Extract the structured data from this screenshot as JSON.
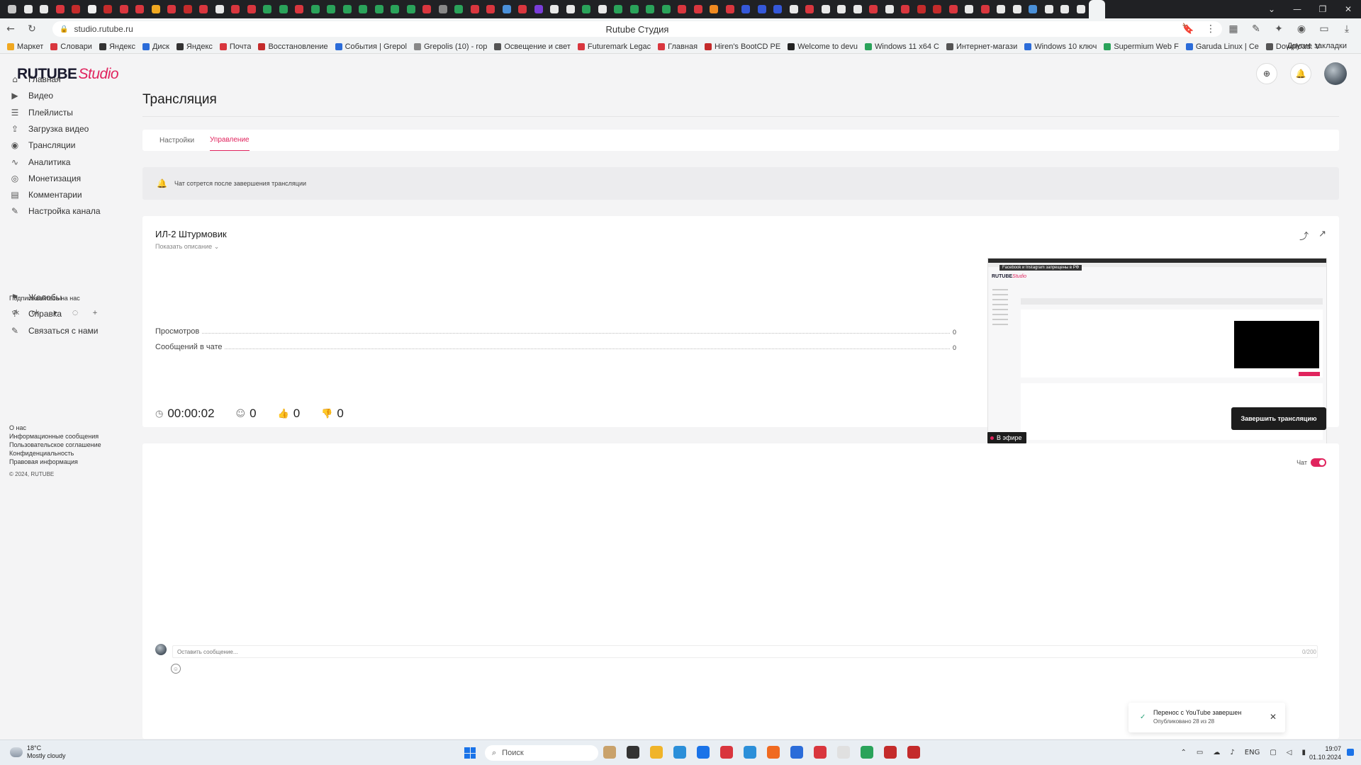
{
  "browser": {
    "url": "studio.rutube.ru",
    "page_title": "Rutube Студия",
    "tab_colors": [
      "#c7c7c7",
      "#e8e8e8",
      "#e8e8e8",
      "#d9363e",
      "#c42b2b",
      "#f0f0f0",
      "#c42b2b",
      "#d9363e",
      "#d9363e",
      "#f0a820",
      "#d9363e",
      "#c42b2b",
      "#d9363e",
      "#e8e8e8",
      "#d9363e",
      "#d9363e",
      "#2aa35a",
      "#2aa35a",
      "#d9363e",
      "#2aa35a",
      "#2aa35a",
      "#2aa35a",
      "#2aa35a",
      "#2aa35a",
      "#2aa35a",
      "#2aa35a",
      "#d9363e",
      "#888888",
      "#2aa35a",
      "#d9363e",
      "#d9363e",
      "#4a90d9",
      "#d9363e",
      "#7a3dd9",
      "#e8e8e8",
      "#e8e8e8",
      "#2aa35a",
      "#e8e8e8",
      "#2aa35a",
      "#2aa35a",
      "#2aa35a",
      "#2aa35a",
      "#d9363e",
      "#d9363e",
      "#f08a20",
      "#d9363e",
      "#3558d9",
      "#3558d9",
      "#3558d9",
      "#e8e8e8",
      "#d9363e",
      "#e8e8e8",
      "#e8e8e8",
      "#e8e8e8",
      "#d9363e",
      "#e8e8e8",
      "#d9363e",
      "#c42b2b",
      "#c42b2b",
      "#d9363e",
      "#e8e8e8",
      "#d9363e",
      "#e8e8e8",
      "#e8e8e8",
      "#4a90d9",
      "#e8e8e8",
      "#e8e8e8",
      "#e8e8e8",
      "#f1f3f4"
    ],
    "bookmarks": [
      "Маркет",
      "Словари",
      "Яндекс",
      "Диск",
      "Яндекс",
      "Почта",
      "Восстановление",
      "События | Grepol",
      "Grepolis (10) - гор",
      "Освещение и свет",
      "Futuremark Legac",
      "Главная",
      "Hiren's BootCD PE",
      "Welcome to devu",
      "Windows 11 x64 C",
      "Интернет-магази",
      "Windows 10 ключ",
      "Supermium Web F",
      "Garuda Linux | Ce",
      "Download. V"
    ],
    "bookmark_colors": [
      "#f0a820",
      "#d9363e",
      "#333333",
      "#2b6cd9",
      "#333333",
      "#d9363e",
      "#c42b2b",
      "#2b6cd9",
      "#888888",
      "#555555",
      "#d9363e",
      "#d9363e",
      "#c42b2b",
      "#222222",
      "#2aa35a",
      "#555555",
      "#2b6cd9",
      "#2aa35a",
      "#2b6cd9",
      "#555555"
    ],
    "other_bookmarks": "Другие закладки"
  },
  "app": {
    "logo_main": "RUTUBE",
    "logo_studio": "Studio",
    "nav": [
      {
        "label": "Главная",
        "icon": "home-icon",
        "glyph": "⌂"
      },
      {
        "label": "Видео",
        "icon": "video-icon",
        "glyph": "▶"
      },
      {
        "label": "Плейлисты",
        "icon": "playlist-icon",
        "glyph": "☰"
      },
      {
        "label": "Загрузка видео",
        "icon": "upload-icon",
        "glyph": "⇪"
      },
      {
        "label": "Трансляции",
        "icon": "broadcast-icon",
        "glyph": "◉"
      },
      {
        "label": "Аналитика",
        "icon": "analytics-icon",
        "glyph": "∿"
      },
      {
        "label": "Монетизация",
        "icon": "monetization-icon",
        "glyph": "◎"
      },
      {
        "label": "Комментарии",
        "icon": "comments-icon",
        "glyph": "▤"
      },
      {
        "label": "Настройка канала",
        "icon": "channel-settings-icon",
        "glyph": "✎"
      }
    ],
    "follow_title": "Подписывайтесь на нас",
    "socials": [
      {
        "icon": "vk-icon",
        "glyph": "vk"
      },
      {
        "icon": "ok-icon",
        "glyph": "ok"
      },
      {
        "icon": "telegram-icon",
        "glyph": "➤"
      },
      {
        "icon": "viber-icon",
        "glyph": "◌"
      },
      {
        "icon": "more-icon",
        "glyph": "+"
      }
    ],
    "nav2": [
      {
        "label": "Жалобы",
        "icon": "flag-icon",
        "glyph": "⚑"
      },
      {
        "label": "Справка",
        "icon": "help-icon",
        "glyph": "?"
      },
      {
        "label": "Связаться с нами",
        "icon": "contact-icon",
        "glyph": "✎"
      }
    ],
    "footer_links": [
      "О нас",
      "Информационные сообщения",
      "Пользовательское соглашение",
      "Конфиденциальность",
      "Правовая информация"
    ],
    "copyright": "© 2024, RUTUBE",
    "page_title": "Трансляция",
    "tabs": [
      {
        "label": "Настройки",
        "active": false
      },
      {
        "label": "Управление",
        "active": true
      }
    ],
    "notice": "Чат сотрется после завершения трансляции",
    "stream": {
      "title": "ИЛ-2 Штурмовик",
      "show_description": "Показать описание",
      "stats": [
        {
          "label": "Просмотров",
          "value": "0"
        },
        {
          "label": "Сообщений в чате",
          "value": "0"
        }
      ],
      "duration": "00:00:02",
      "viewers": "0",
      "likes": "0",
      "dislikes": "0",
      "live_badge": "В эфире",
      "end_button": "Завершить трансляцию",
      "preview_banner": "Facebook и Instagram запрещены в РФ",
      "preview_logo_main": "RUTUBE",
      "preview_logo_studio": "Studio"
    },
    "chat": {
      "toggle_label": "Чат",
      "toggle_on": true,
      "placeholder": "Оставить сообщение...",
      "counter": "0/200"
    },
    "toast": {
      "title": "Перенос с YouTube завершен",
      "subtitle": "Опубликовано 28 из 28"
    },
    "accent_color": "#e0245e"
  },
  "taskbar": {
    "weather_temp": "18°C",
    "weather_desc": "Mostly cloudy",
    "search_placeholder": "Поиск",
    "app_colors": [
      "#c9a26b",
      "#333333",
      "#f0b429",
      "#2b8fd9",
      "#1a73e8",
      "#d9363e",
      "#2b8fd9",
      "#f06a20",
      "#2b6cd9",
      "#d9363e",
      "#e0e0e0",
      "#2aa35a",
      "#c42b2b",
      "#c42b2b"
    ],
    "lang": "ENG",
    "time": "19:07",
    "date": "01.10.2024"
  }
}
